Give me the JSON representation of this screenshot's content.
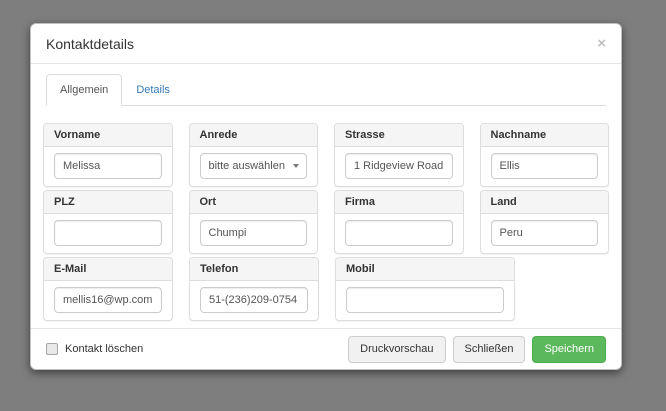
{
  "modal": {
    "title": "Kontaktdetails",
    "close_glyph": "×"
  },
  "tabs": [
    {
      "label": "Allgemein",
      "active": true
    },
    {
      "label": "Details",
      "active": false
    }
  ],
  "fields": {
    "vorname": {
      "label": "Vorname",
      "value": "Melissa"
    },
    "anrede": {
      "label": "Anrede",
      "value": "bitte auswählen"
    },
    "strasse": {
      "label": "Strasse",
      "value": "1 Ridgeview Road"
    },
    "nachname": {
      "label": "Nachname",
      "value": "Ellis"
    },
    "plz": {
      "label": "PLZ",
      "value": ""
    },
    "ort": {
      "label": "Ort",
      "value": "Chumpi"
    },
    "firma": {
      "label": "Firma",
      "value": ""
    },
    "land": {
      "label": "Land",
      "value": "Peru"
    },
    "email": {
      "label": "E-Mail",
      "value": "mellis16@wp.com"
    },
    "telefon": {
      "label": "Telefon",
      "value": "51-(236)209-0754"
    },
    "mobil": {
      "label": "Mobil",
      "value": ""
    }
  },
  "footer": {
    "checkbox_label": "Kontakt löschen",
    "buttons": [
      {
        "label": "Druckvorschau",
        "style": "default"
      },
      {
        "label": "Schließen",
        "style": "default"
      },
      {
        "label": "Speichern",
        "style": "success"
      }
    ]
  },
  "colors": {
    "accent_green": "#5cb85c",
    "accent_green_border": "#4cae4c",
    "link_blue": "#337ab7",
    "backdrop": "#7e7e7e",
    "panel_header_bg": "#f5f5f5"
  }
}
